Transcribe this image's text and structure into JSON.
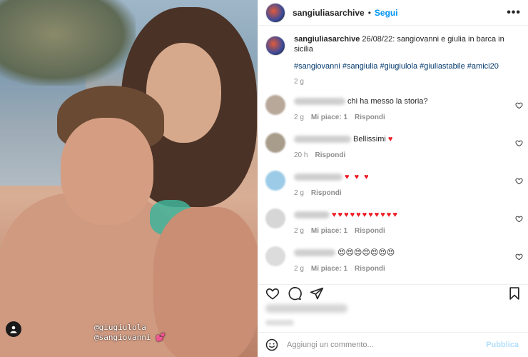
{
  "post": {
    "story_tag_line1": "@giugiulola",
    "story_tag_line2": "@sangiovanni",
    "story_tag_heart": "💕"
  },
  "header": {
    "username": "sangiuliasarchive",
    "separator": "•",
    "follow_label": "Segui",
    "more_label": "•••"
  },
  "caption": {
    "username": "sangiuliasarchive",
    "text": " 26/08/22: sangiovanni e giulia in barca in sicilia",
    "hashtags": "#sangiovanni #sangiulia #giugiulola #giuliastabile #amici20",
    "time": "2 g"
  },
  "comments": [
    {
      "text": "chi ha messo la storia?",
      "hearts": "",
      "time": "2 g",
      "likes": "Mi piace: 1",
      "reply": "Rispondi"
    },
    {
      "text": "Bellissimi ",
      "hearts": "♥",
      "time": "20 h",
      "likes": "",
      "reply": "Rispondi"
    },
    {
      "text": "",
      "hearts": "♥ ♥ ♥",
      "time": "2 g",
      "likes": "",
      "reply": "Rispondi"
    },
    {
      "text": "",
      "hearts": "♥♥♥♥♥♥♥♥♥♥♥",
      "time": "2 g",
      "likes": "Mi piace: 1",
      "reply": "Rispondi"
    },
    {
      "text": "",
      "hearts": "😍😍😍😍😍😍😍",
      "time": "2 g",
      "likes": "Mi piace: 1",
      "reply": "Rispondi"
    }
  ],
  "add_comment": {
    "placeholder": "Aggiungi un commento...",
    "publish_label": "Pubblica"
  },
  "colors": {
    "accent": "#0095f6",
    "hashtag": "#00376b",
    "heart": "#ed1c24",
    "publish_disabled": "#b2dffc"
  }
}
